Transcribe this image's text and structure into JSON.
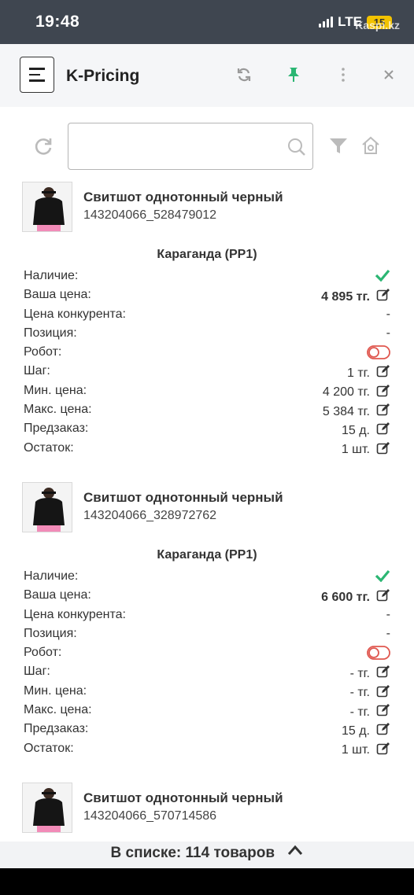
{
  "statusbar": {
    "time": "19:48",
    "network": "LTE",
    "battery": "15",
    "watermark": "Kaspi.kz"
  },
  "app": {
    "title": "K-Pricing"
  },
  "search": {
    "value": "",
    "placeholder": ""
  },
  "products": [
    {
      "name": "Свитшот однотонный черный",
      "sku": "143204066_528479012",
      "city": "Караганда (PP1)",
      "rows": [
        {
          "label": "Наличие:",
          "value": "",
          "kind": "check"
        },
        {
          "label": "Ваша цена:",
          "value": "4 895 тг.",
          "kind": "price"
        },
        {
          "label": "Цена конкурента:",
          "value": "-",
          "kind": "text"
        },
        {
          "label": "Позиция:",
          "value": "-",
          "kind": "text"
        },
        {
          "label": "Робот:",
          "value": "",
          "kind": "toggle"
        },
        {
          "label": "Шаг:",
          "value": "1 тг.",
          "kind": "edit"
        },
        {
          "label": "Мин. цена:",
          "value": "4 200 тг.",
          "kind": "edit"
        },
        {
          "label": "Макс. цена:",
          "value": "5 384 тг.",
          "kind": "edit"
        },
        {
          "label": "Предзаказ:",
          "value": "15 д.",
          "kind": "edit"
        },
        {
          "label": "Остаток:",
          "value": "1 шт.",
          "kind": "edit"
        }
      ]
    },
    {
      "name": "Свитшот однотонный черный",
      "sku": "143204066_328972762",
      "city": "Караганда (PP1)",
      "rows": [
        {
          "label": "Наличие:",
          "value": "",
          "kind": "check"
        },
        {
          "label": "Ваша цена:",
          "value": "6 600 тг.",
          "kind": "price"
        },
        {
          "label": "Цена конкурента:",
          "value": "-",
          "kind": "text"
        },
        {
          "label": "Позиция:",
          "value": "-",
          "kind": "text"
        },
        {
          "label": "Робот:",
          "value": "",
          "kind": "toggle"
        },
        {
          "label": "Шаг:",
          "value": "- тг.",
          "kind": "edit"
        },
        {
          "label": "Мин. цена:",
          "value": "- тг.",
          "kind": "edit"
        },
        {
          "label": "Макс. цена:",
          "value": "- тг.",
          "kind": "edit"
        },
        {
          "label": "Предзаказ:",
          "value": "15 д.",
          "kind": "edit"
        },
        {
          "label": "Остаток:",
          "value": "1 шт.",
          "kind": "edit"
        }
      ]
    },
    {
      "name": "Свитшот однотонный черный",
      "sku": "143204066_570714586",
      "city": "",
      "rows": []
    }
  ],
  "footer": {
    "count_text": "В списке: 114 товаров"
  },
  "colors": {
    "accent_green": "#2bb673",
    "toggle_red": "#e0574f",
    "header_bg": "#f5f6f8",
    "statusbar_bg": "#3f4650"
  },
  "icons": [
    "menu-icon",
    "refresh-icon",
    "pin-icon",
    "more-vert-icon",
    "close-icon",
    "reload-icon",
    "search-icon",
    "filter-icon",
    "home-settings-icon",
    "check-icon",
    "toggle-off-icon",
    "edit-icon",
    "chevron-up-icon"
  ]
}
